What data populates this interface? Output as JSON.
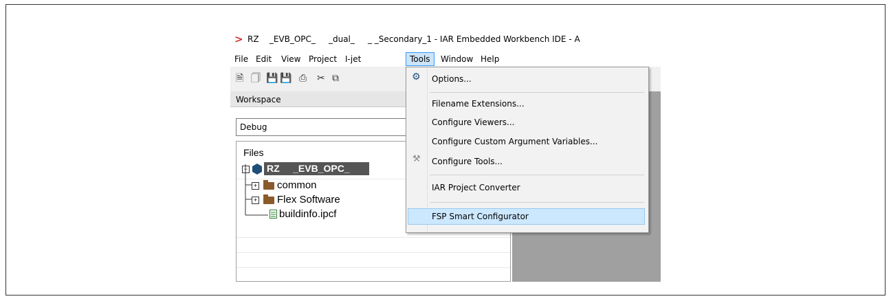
{
  "window": {
    "title": "RZ    _EVB_OPC_     _dual_     _ _Secondary_1 - IAR Embedded Workbench IDE - A"
  },
  "menubar": {
    "items": [
      "File",
      "Edit",
      "View",
      "Project",
      "I-jet",
      "Tools",
      "Window",
      "Help"
    ],
    "active": "Tools"
  },
  "workspace": {
    "title": "Workspace",
    "config": "Debug",
    "files_header": "Files",
    "project": "RZ     _EVB_OPC_",
    "nodes": [
      "common",
      "Flex Software",
      "buildinfo.ipcf"
    ]
  },
  "tools_menu": {
    "items": [
      "Options...",
      "Filename Extensions...",
      "Configure Viewers...",
      "Configure Custom Argument Variables...",
      "Configure Tools...",
      "IAR Project Converter",
      "FSP Smart Configurator"
    ],
    "highlighted": "FSP Smart Configurator"
  },
  "icons": {
    "title": "iar-arrow-icon",
    "options": "gear-icon",
    "tools": "tools-icon"
  },
  "colors": {
    "highlight": "#cce8ff",
    "accent": "#3399ff",
    "arrow": "#d32f2f"
  }
}
